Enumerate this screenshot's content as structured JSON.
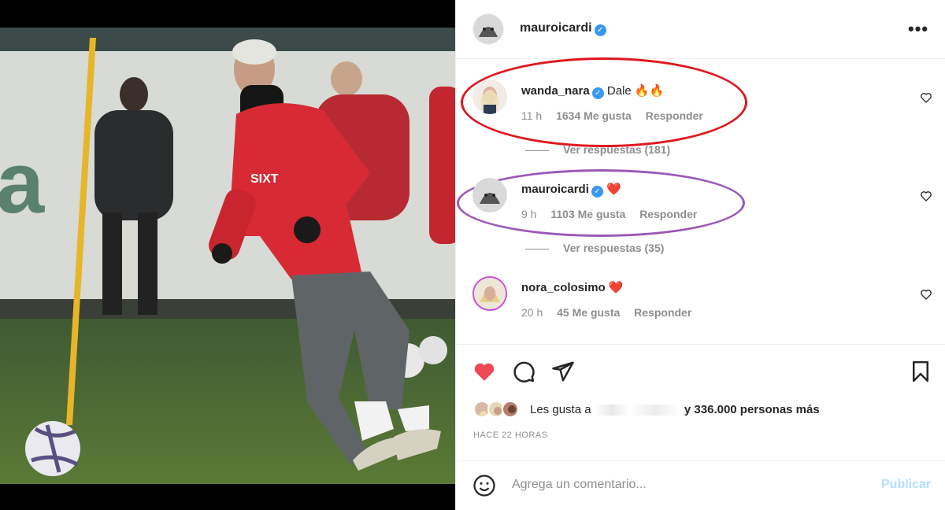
{
  "post": {
    "author": "mauroicardi",
    "more_icon": "more-horizontal-icon"
  },
  "comments": [
    {
      "user": "wanda_nara",
      "verified": true,
      "text": "Dale 🔥🔥",
      "time": "11 h",
      "likes": "1634 Me gusta",
      "reply": "Responder",
      "view_replies": "Ver respuestas (181)",
      "highlight": "#e0161d"
    },
    {
      "user": "mauroicardi",
      "verified": true,
      "text": "❤️",
      "time": "9 h",
      "likes": "1103 Me gusta",
      "reply": "Responder",
      "view_replies": "Ver respuestas (35)",
      "highlight": "#9b59b6"
    },
    {
      "user": "nora_colosimo",
      "verified": false,
      "text": "❤️",
      "time": "20 h",
      "likes": "45 Me gusta",
      "reply": "Responder"
    }
  ],
  "actions": {
    "like_icon": "heart-filled-icon",
    "comment_icon": "comment-icon",
    "share_icon": "send-icon",
    "save_icon": "bookmark-icon",
    "like_color": "#ed4956"
  },
  "likes": {
    "prefix": "Les gusta a",
    "hidden_names": ", ",
    "suffix": "y 336.000 personas más"
  },
  "posted": "HACE 22 HORAS",
  "add_comment": {
    "placeholder": "Agrega un comentario...",
    "publish_label": "Publicar",
    "emoji_icon": "smile-icon"
  }
}
